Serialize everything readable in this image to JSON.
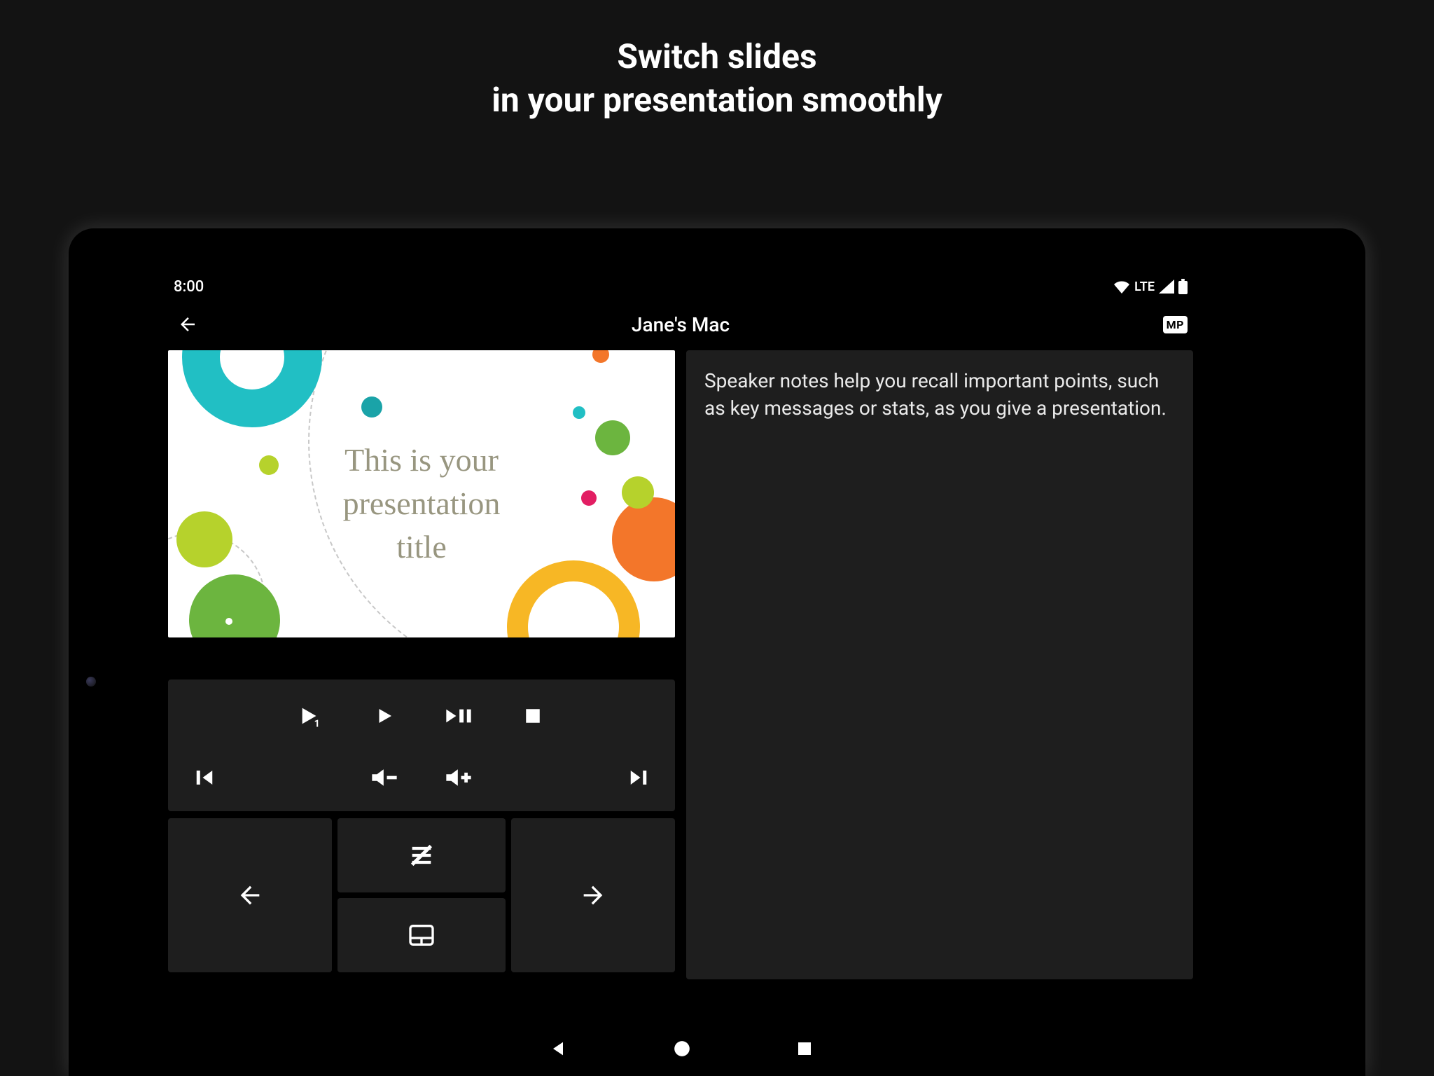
{
  "promo": {
    "line1": "Switch slides",
    "line2": "in your presentation smoothly"
  },
  "status": {
    "time": "8:00",
    "network": "LTE"
  },
  "header": {
    "title": "Jane's Mac",
    "badge": "MP"
  },
  "slide": {
    "title_l1": "This is your",
    "title_l2": "presentation",
    "title_l3": "title"
  },
  "notes": "Speaker notes help you recall important points, such as key messages or stats, as you give a presentation.",
  "icons": {
    "back": "back-arrow",
    "play_start": "play-from-start",
    "play": "play",
    "play_pause": "play-pause",
    "stop": "stop",
    "first": "first-slide",
    "vol_down": "volume-down",
    "vol_up": "volume-up",
    "last": "last-slide",
    "prev": "arrow-left",
    "next": "arrow-right",
    "no_list": "disable-list",
    "app_switch": "touchpad"
  }
}
